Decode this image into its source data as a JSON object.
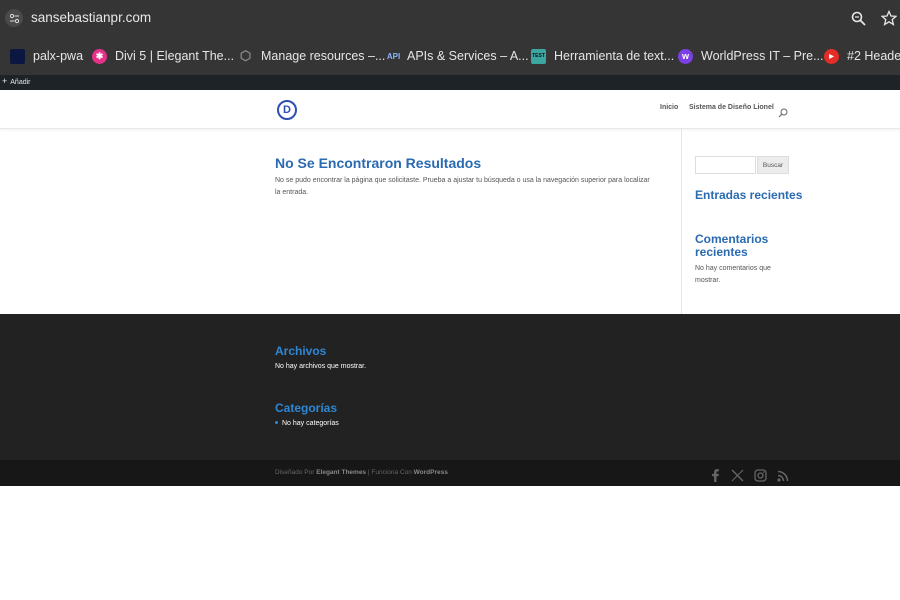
{
  "browser": {
    "url": "sansebastianpr.com",
    "icons": [
      "site-settings-icon",
      "zoom-icon",
      "star-icon"
    ]
  },
  "bookmarks": [
    {
      "label": "palx-pwa",
      "icon": "palx-icon",
      "color": "#0b1740"
    },
    {
      "label": "Divi 5 | Elegant The...",
      "icon": "divi-icon",
      "color": "#e4318a"
    },
    {
      "label": "Manage resources –...",
      "icon": "cloud-icon",
      "color": "#5f6368"
    },
    {
      "label": "APIs & Services – A...",
      "icon": "api-icon",
      "color": "#4c8bf5"
    },
    {
      "label": "Herramienta de text...",
      "icon": "test-icon",
      "color": "#3ea6a0"
    },
    {
      "label": "WorldPress IT – Pre...",
      "icon": "wordpress-icon",
      "color": "#7b3fe4"
    },
    {
      "label": "#2 Header",
      "icon": "youtube-icon",
      "color": "#e52d27"
    }
  ],
  "wp_admin": {
    "add_label": "Añadir"
  },
  "header": {
    "logo_letter": "D",
    "nav": [
      "Inicio",
      "Sistema de Diseño Lionel"
    ]
  },
  "main": {
    "title": "No Se Encontraron Resultados",
    "text": "No se pudo encontrar la página que solicitaste. Prueba a ajustar tu búsqueda o usa la navegación superior para localizar la entrada."
  },
  "sidebar": {
    "search_button": "Buscar",
    "recent_posts": "Entradas recientes",
    "recent_comments": "Comentarios recientes",
    "no_comments": "No hay comentarios que mostrar."
  },
  "footer": {
    "archives_title": "Archivos",
    "archives_text": "No hay archivos que mostrar.",
    "categories_title": "Categorías",
    "categories_text": "No hay categorías"
  },
  "credits": {
    "designed_by": "Diseñado Por",
    "theme": "Elegant Themes",
    "separator": "| Funciona Con",
    "platform": "WordPress"
  },
  "colors": {
    "accent": "#2a6ab1",
    "footer_accent": "#2e87d4",
    "browser_bg": "#353535"
  }
}
